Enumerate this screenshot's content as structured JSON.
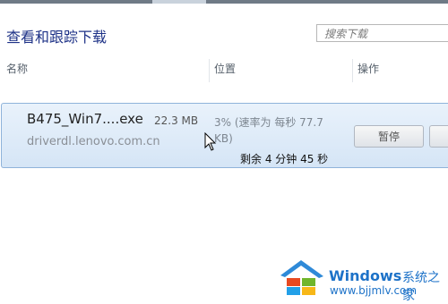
{
  "window": {
    "title": "查看和跟踪下载"
  },
  "search": {
    "placeholder": "搜索下载"
  },
  "columns": {
    "name": "名称",
    "location": "位置",
    "actions": "操作"
  },
  "download": {
    "filename": "B475_Win7....exe",
    "size": "22.3 MB",
    "source": "driverdl.lenovo.com.cn",
    "progress_text": "3% (速率为 每秒 77.7 KB)",
    "remaining": "剩余  4 分钟 45 秒",
    "pause_label": "暂停"
  },
  "watermark": {
    "brand": "Windows",
    "brand_cn": "系统之家",
    "url": "www.bjjmlv.com"
  },
  "colors": {
    "title": "#1e3287",
    "row_bg": "#dce9f7",
    "row_border": "#8fb3da",
    "watermark": "#1d72c8"
  }
}
